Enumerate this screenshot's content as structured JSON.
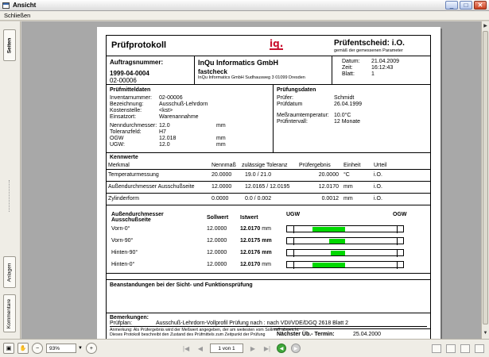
{
  "window": {
    "title": "Ansicht",
    "min": "_",
    "max": "□",
    "close": "✕"
  },
  "menu": {
    "close_label": "Schließen"
  },
  "side_tabs": {
    "pages": "Seiten",
    "attachments": "Anlagen",
    "comments": "Kommentare"
  },
  "doc": {
    "title": "Prüfprotokoll",
    "logo": "iq.",
    "verdict": "Prüfentscheid: i.O.",
    "verdict_note": "gemäß der gemessenen Parameter",
    "order_label": "Auftragsnummer:",
    "order_no": "1999-04-0004",
    "order_sub": "02-00006",
    "company": "InQu Informatics GmbH",
    "company_sub": "fastcheck",
    "company_addr": "InQu Informatics GmbH  Sudhausweg 3  01099 Dresden",
    "meta": [
      {
        "k": "Datum:",
        "v": "21.04.2009"
      },
      {
        "k": "Zeit:",
        "v": "16:12:43"
      },
      {
        "k": "Blatt:",
        "v": "1"
      }
    ],
    "pm_title": "Prüfmitteldaten",
    "pm": [
      {
        "k": "Inventarnummer:",
        "v": "02-00006",
        "u": ""
      },
      {
        "k": "Bezeichnung:",
        "v": "Ausschuß-Lehrdorn",
        "u": ""
      },
      {
        "k": "Kostenstelle:",
        "v": "<kst>",
        "u": ""
      },
      {
        "k": "Einsatzort:",
        "v": "Warenannahme",
        "u": ""
      },
      {
        "k": "",
        "v": "",
        "u": ""
      },
      {
        "k": "Nenndurchmesser:",
        "v": "12.0",
        "u": "mm"
      },
      {
        "k": "Toleranzfeld:",
        "v": "H7",
        "u": ""
      },
      {
        "k": "OGW",
        "v": "12.018",
        "u": "mm"
      },
      {
        "k": "UGW:",
        "v": "12.0",
        "u": "mm"
      }
    ],
    "pd_title": "Prüfungsdaten",
    "pd": [
      {
        "k": "Prüfer:",
        "v": "Schmidt"
      },
      {
        "k": "Prüfdatum",
        "v": "26.04.1999"
      },
      {
        "k": "",
        "v": ""
      },
      {
        "k": "Meßraumtemperatur:",
        "v": "10.0°C"
      },
      {
        "k": "Prüfintervall:",
        "v": "12  Monate"
      }
    ],
    "next_label": "Nächster Üb.- Termin:",
    "next_date": "25.04.2000",
    "kw_title": "Kennwerte",
    "kw_headers": [
      "Merkmal",
      "Nennmaß",
      "zulässige Toleranz",
      "Prüfergebnis",
      "Einheit",
      "Urteil"
    ],
    "kw_rows": [
      [
        "Temperaturmessung",
        "20.0000",
        "19.0 / 21.0",
        "20.0000",
        "°C",
        "i.O."
      ],
      [
        "Außendurchmesser Ausschußseite",
        "12.0000",
        "12.0165 / 12.0195",
        "12.0170",
        "mm",
        "i.O."
      ],
      [
        "Zylinderform",
        "0.0000",
        "0.0 / 0.002",
        "0.0012",
        "mm",
        "i.O."
      ]
    ],
    "od_headers": [
      "Außendurchmesser Ausschußseite",
      "Sollwert",
      "Istwert",
      "UGW",
      "OGW"
    ],
    "od_rows": [
      {
        "name": "Vorn-0°",
        "soll": "12.0000",
        "ist": "12.0170",
        "unit": "mm",
        "start": 0.22,
        "end": 0.5
      },
      {
        "name": "Vorn-90°",
        "soll": "12.0000",
        "ist": "12.0175 mm",
        "unit": "",
        "start": 0.36,
        "end": 0.5
      },
      {
        "name": "Hinten-90°",
        "soll": "12.0000",
        "ist": "12.0176 mm",
        "unit": "",
        "start": 0.38,
        "end": 0.5
      },
      {
        "name": "Hinten-0°",
        "soll": "12.0000",
        "ist": "12.0170",
        "unit": "mm",
        "start": 0.22,
        "end": 0.5
      }
    ],
    "beanst": "Beanstandungen bei der Sicht- und Funktionsprüfung",
    "bemerk_title": "Bemerkungen:",
    "bemerk_k": "Prüfplan:",
    "bemerk_v": "Ausschuß-Lehrdorn-Vollprofil   Prüfung  nach :   nach VDI/VDE/DGQ 2618 Blatt 2",
    "note1": "Anmerkung: Als Prüfergebnis wird der Meßwert angegeben, der am weitesten vom Sollmaß abweicht.",
    "note2": "Dieses Protokoll beschreibt den Zustand des Prüfmittels zum Zeitpunkt der Prüfung"
  },
  "status": {
    "zoom": "93%",
    "page": "1 von 1"
  },
  "colors": {
    "fill": "#00d800",
    "logo": "#c8102e"
  }
}
